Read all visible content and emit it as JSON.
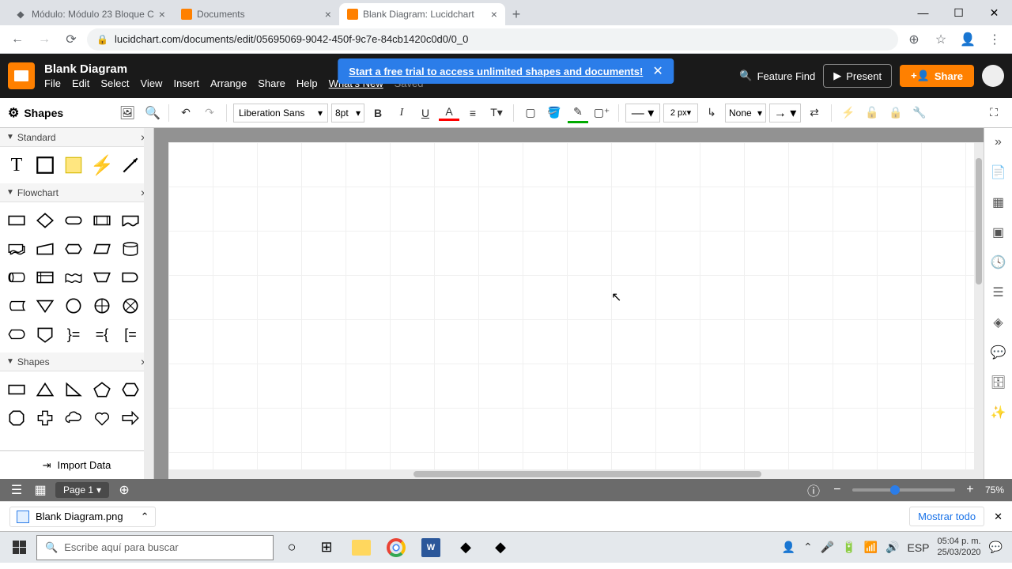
{
  "browser": {
    "tabs": [
      {
        "title": "Módulo: Módulo 23 Bloque C"
      },
      {
        "title": "Documents"
      },
      {
        "title": "Blank Diagram: Lucidchart"
      }
    ],
    "url": "lucidchart.com/documents/edit/05695069-9042-450f-9c7e-84cb1420c0d0/0_0"
  },
  "lucid": {
    "doc_title": "Blank Diagram",
    "menus": {
      "file": "File",
      "edit": "Edit",
      "select": "Select",
      "view": "View",
      "insert": "Insert",
      "arrange": "Arrange",
      "share": "Share",
      "help": "Help",
      "whatsnew": "What's New",
      "saved": "Saved"
    },
    "banner": "Start a free trial to access unlimited shapes and documents!",
    "feature_find": "Feature Find",
    "present": "Present",
    "share_btn": "Share"
  },
  "toolbar": {
    "shapes_label": "Shapes",
    "font": "Liberation Sans",
    "font_size": "8pt",
    "line_width": "2 px",
    "line_start": "None"
  },
  "sidebar": {
    "sections": {
      "standard": "Standard",
      "flowchart": "Flowchart",
      "shapes": "Shapes"
    },
    "import": "Import Data"
  },
  "footer": {
    "page": "Page 1",
    "zoom": "75%"
  },
  "download": {
    "file": "Blank Diagram.png",
    "showall": "Mostrar todo"
  },
  "taskbar": {
    "search_placeholder": "Escribe aquí para buscar",
    "lang": "ESP",
    "time": "05:04 p. m.",
    "date": "25/03/2020"
  }
}
